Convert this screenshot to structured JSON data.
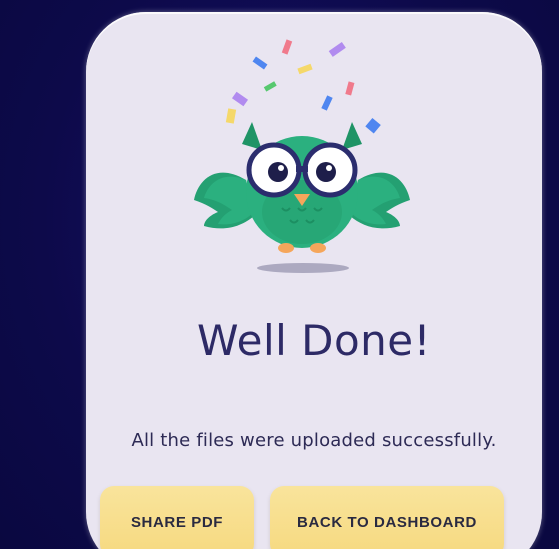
{
  "dialog": {
    "title": "Well Done!",
    "message": "All the files were uploaded successfully.",
    "illustration": "celebrating-owl-with-confetti"
  },
  "actions": {
    "share_label": "SHARE PDF",
    "dashboard_label": "BACK TO DASHBOARD"
  },
  "colors": {
    "background": "#0d0a4a",
    "card": "#e9e5f1",
    "title_text": "#2d2a66",
    "button": "#f6d97f",
    "owl_body": "#2bb07f"
  }
}
